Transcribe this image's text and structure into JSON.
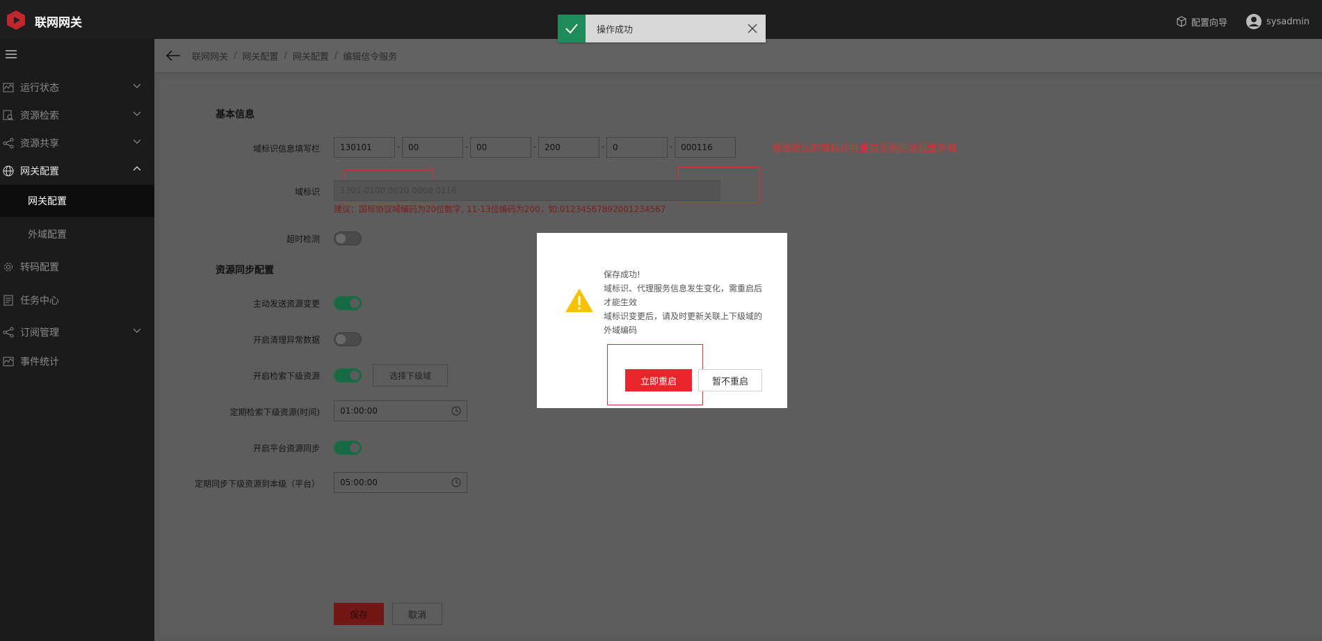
{
  "app": {
    "title": "联网网关"
  },
  "topbar": {
    "config_wizard": "配置向导",
    "user": "sysadmin"
  },
  "sidebar": {
    "items": [
      {
        "label": "运行状态",
        "icon": "line-chart-icon"
      },
      {
        "label": "资源检索",
        "icon": "search-doc-icon"
      },
      {
        "label": "资源共享",
        "icon": "share-icon"
      },
      {
        "label": "网关配置",
        "icon": "globe-icon"
      },
      {
        "label": "转码配置",
        "icon": "gear-icon"
      },
      {
        "label": "任务中心",
        "icon": "task-doc-icon"
      },
      {
        "label": "订阅管理",
        "icon": "share-icon"
      },
      {
        "label": "事件统计",
        "icon": "line-chart-icon"
      }
    ],
    "subitems": [
      {
        "label": "网关配置"
      },
      {
        "label": "外域配置"
      }
    ]
  },
  "breadcrumb": [
    "联网网关",
    "网关配置",
    "网关配置",
    "编辑信令服务"
  ],
  "form": {
    "basic_title": "基本信息",
    "domain_fill_label": "域标识信息填写栏",
    "domain_parts": [
      "130101",
      "00",
      "00",
      "200",
      "0",
      "000116"
    ],
    "domain_note": "修改默认的域标识并重启否则无法配置外域",
    "domain_id_label": "域标识",
    "domain_id_value": "1301 0100 0020 0000 0116",
    "domain_hint": "建议：国标协议域编码为20位数字, 11-13位编码为200，如:01234567892001234567",
    "timeout_label": "超时检测",
    "sync_title": "资源同步配置",
    "active_send_label": "主动发送资源变更",
    "clean_abnormal_label": "开启清理异常数据",
    "search_lower_label": "开启检索下级资源",
    "select_lower_btn": "选择下级域",
    "periodic_search_label": "定期检索下级资源(时间)",
    "periodic_search_value": "01:00:00",
    "platform_sync_label": "开启平台资源同步",
    "periodic_sync_label": "定期同步下级资源到本级（平台）",
    "periodic_sync_value": "05:00:00",
    "save_btn": "保存",
    "cancel_btn": "取消"
  },
  "toggles": {
    "timeout": false,
    "active_send": true,
    "clean_abnormal": false,
    "search_lower": true,
    "platform_sync": true
  },
  "toast": {
    "text": "操作成功"
  },
  "dialog": {
    "lines": [
      "保存成功!",
      "域标识、代理服务信息发生变化，需重启后",
      "才能生效",
      "域标识变更后，请及时更新关联上下级域的",
      "外域编码"
    ],
    "restart_btn": "立即重启",
    "later_btn": "暂不重启"
  },
  "colors": {
    "accent_red": "#e8252a",
    "success_green": "#1f8a5a",
    "annotation_red": "#d93030"
  }
}
